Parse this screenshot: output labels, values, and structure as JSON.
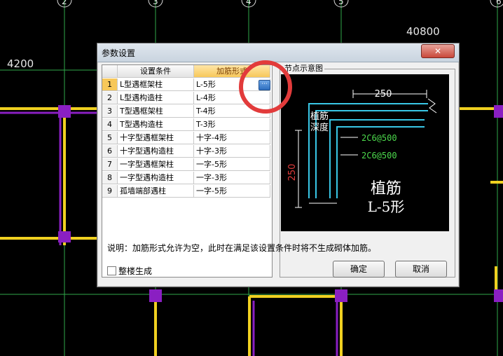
{
  "background": {
    "axis_labels": [
      "2",
      "3",
      "4",
      "5",
      "6"
    ],
    "dim_top_right": "40800",
    "dim_left": "4200",
    "colors": {
      "grid_line": "#2fa84a",
      "wall": "#f0d020",
      "column": "#8a1fc2"
    }
  },
  "dialog": {
    "title": "参数设置",
    "close_icon": "close-icon",
    "grid": {
      "headers": {
        "condition": "设置条件",
        "form": "加筋形式"
      },
      "rows": [
        {
          "num": "1",
          "condition": "L型遇框架柱",
          "form": "L-5形"
        },
        {
          "num": "2",
          "condition": "L型遇构造柱",
          "form": "L-4形"
        },
        {
          "num": "3",
          "condition": "T型遇框架柱",
          "form": "T-4形"
        },
        {
          "num": "4",
          "condition": "T型遇构造柱",
          "form": "T-3形"
        },
        {
          "num": "5",
          "condition": "十字型遇框架柱",
          "form": "十字-4形"
        },
        {
          "num": "6",
          "condition": "十字型遇构造柱",
          "form": "十字-3形"
        },
        {
          "num": "7",
          "condition": "一字型遇框架柱",
          "form": "一字-5形"
        },
        {
          "num": "8",
          "condition": "一字型遇构造柱",
          "form": "一字-3形"
        },
        {
          "num": "9",
          "condition": "孤墙端部遇柱",
          "form": "一字-5形"
        }
      ],
      "ellipsis_label": "···"
    },
    "node_diagram": {
      "group_label": "节点示意图",
      "dim_top": "250",
      "dim_left": "250",
      "label_depth_line1": "植筋",
      "label_depth_line2": "深度",
      "rebar_1": "2C6@500",
      "rebar_2": "2C6@500",
      "title_line1": "植筋",
      "title_line2": "L-5形",
      "colors": {
        "rebar": "#39c7e6",
        "dimension": "#ffffff",
        "depth": "#e23b3b",
        "annotation": "#4cd94c"
      }
    },
    "hint": "说明：加筋形式允许为空，此时在满足该设置条件时将不生成砌体加筋。",
    "whole_building_label": "整楼生成",
    "whole_building_checked": false,
    "ok_label": "确定",
    "cancel_label": "取消"
  }
}
